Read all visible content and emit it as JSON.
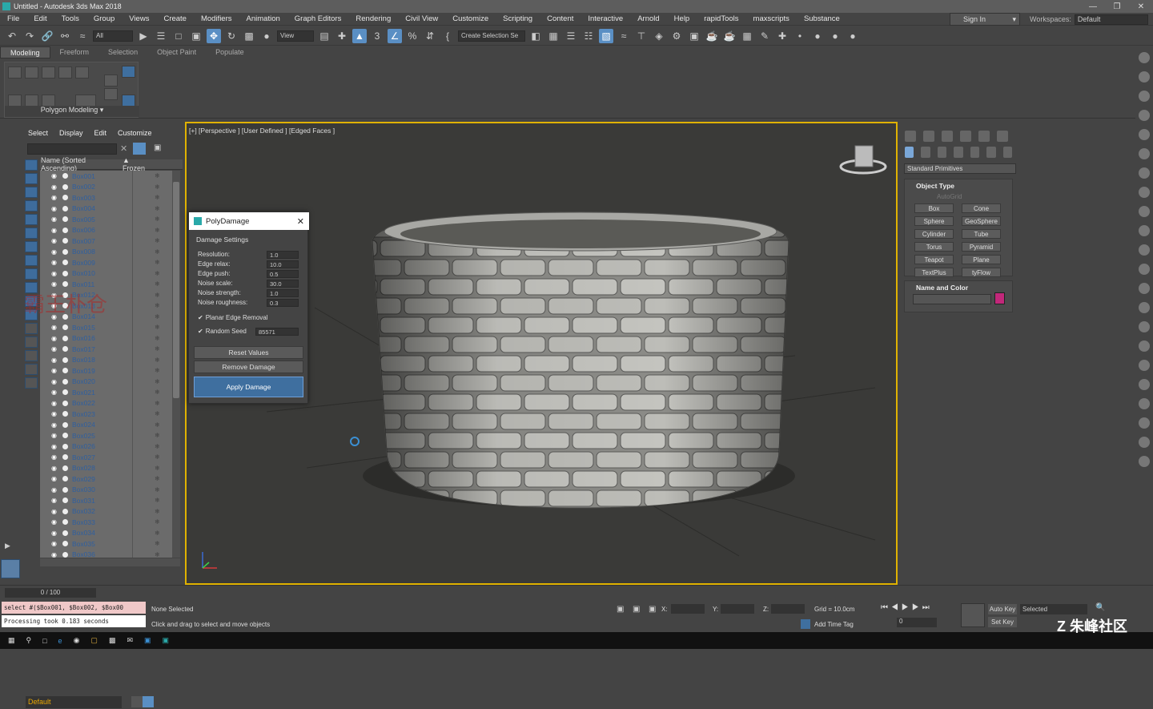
{
  "window": {
    "title": "Untitled - Autodesk 3ds Max 2018"
  },
  "menu": [
    "File",
    "Edit",
    "Tools",
    "Group",
    "Views",
    "Create",
    "Modifiers",
    "Animation",
    "Graph Editors",
    "Rendering",
    "Civil View",
    "Customize",
    "Scripting",
    "Content",
    "Interactive",
    "Arnold",
    "Help",
    "rapidTools",
    "maxscripts",
    "Substance"
  ],
  "account": {
    "signin": "Sign In",
    "workspaces_label": "Workspaces:",
    "workspace": "Default"
  },
  "toolbar": {
    "filter": "All",
    "refcoord": "View",
    "selection_set": "Create Selection Se"
  },
  "ribbon": {
    "tabs": [
      "Modeling",
      "Freeform",
      "Selection",
      "Object Paint",
      "Populate"
    ],
    "panel_label": "Polygon Modeling"
  },
  "explorer": {
    "menu": [
      "Select",
      "Display",
      "Edit",
      "Customize"
    ],
    "col_name": "Name (Sorted Ascending)",
    "col_frozen": "▲ Frozen",
    "items": [
      "Box001",
      "Box002",
      "Box003",
      "Box004",
      "Box005",
      "Box006",
      "Box007",
      "Box008",
      "Box009",
      "Box010",
      "Box011",
      "Box012",
      "Box013",
      "Box014",
      "Box015",
      "Box016",
      "Box017",
      "Box018",
      "Box019",
      "Box020",
      "Box021",
      "Box022",
      "Box023",
      "Box024",
      "Box025",
      "Box026",
      "Box027",
      "Box028",
      "Box029",
      "Box030",
      "Box031",
      "Box032",
      "Box033",
      "Box034",
      "Box035",
      "Box036"
    ],
    "layer": "Default"
  },
  "viewport": {
    "label": "[+] [Perspective ] [User Defined ] [Edged Faces ]"
  },
  "polydamage": {
    "title": "PolyDamage",
    "section": "Damage Settings",
    "params": [
      {
        "label": "Resolution:",
        "value": "1.0"
      },
      {
        "label": "Edge relax:",
        "value": "10.0"
      },
      {
        "label": "Edge push:",
        "value": "0.5"
      },
      {
        "label": "Noise scale:",
        "value": "30.0"
      },
      {
        "label": "Noise strength:",
        "value": "1.0"
      },
      {
        "label": "Noise roughness:",
        "value": "0.3"
      }
    ],
    "planar": "Planar Edge Removal",
    "seed_label": "Random Seed",
    "seed": "85571",
    "reset": "Reset Values",
    "remove": "Remove Damage",
    "apply": "Apply Damage"
  },
  "command_panel": {
    "category": "Standard Primitives",
    "object_type": "Object Type",
    "autogrid": "AutoGrid",
    "buttons": [
      "Box",
      "Cone",
      "Sphere",
      "GeoSphere",
      "Cylinder",
      "Tube",
      "Torus",
      "Pyramid",
      "Teapot",
      "Plane",
      "TextPlus",
      "tyFlow"
    ],
    "name_color": "Name and Color",
    "color": "#c2287a"
  },
  "status": {
    "frame": "0 / 100",
    "script": "select #($Box001, $Box002, $Box00",
    "processing": "Processing took 0.183 seconds",
    "selected": "None Selected",
    "prompt": "Click and drag to select and move objects",
    "x_label": "X:",
    "y_label": "Y:",
    "z_label": "Z:",
    "grid": "Grid = 10.0cm",
    "add_time_tag": "Add Time Tag",
    "autokey": "Auto Key",
    "setkey": "Set Key",
    "selected_dd": "Selected",
    "frame_field": "0"
  },
  "watermark": {
    "cn": "霸王朴仓"
  }
}
